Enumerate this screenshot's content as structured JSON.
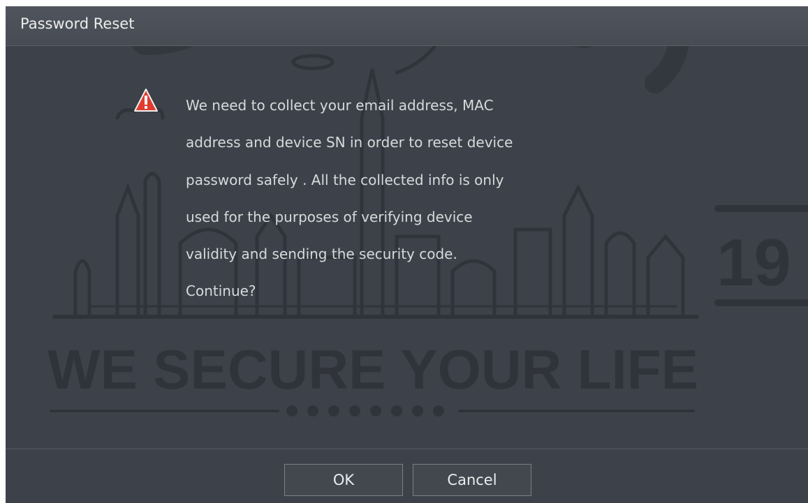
{
  "dialog": {
    "title": "Password Reset",
    "icon": "warning-triangle-icon",
    "message_lines": [
      "We need to collect your email address, MAC",
      "address and device SN in order to reset device",
      "password safely . All the collected info is only",
      "used for the purposes of verifying device",
      "validity and sending the security code.",
      "Continue?"
    ],
    "ok_label": "OK",
    "cancel_label": "Cancel"
  },
  "background": {
    "slogan": "WE SECURE YOUR LIFE",
    "year_fragment": "19"
  },
  "colors": {
    "dialog_bg": "#3d424a",
    "warning": "#e03b2f",
    "text": "#d7d9db"
  }
}
